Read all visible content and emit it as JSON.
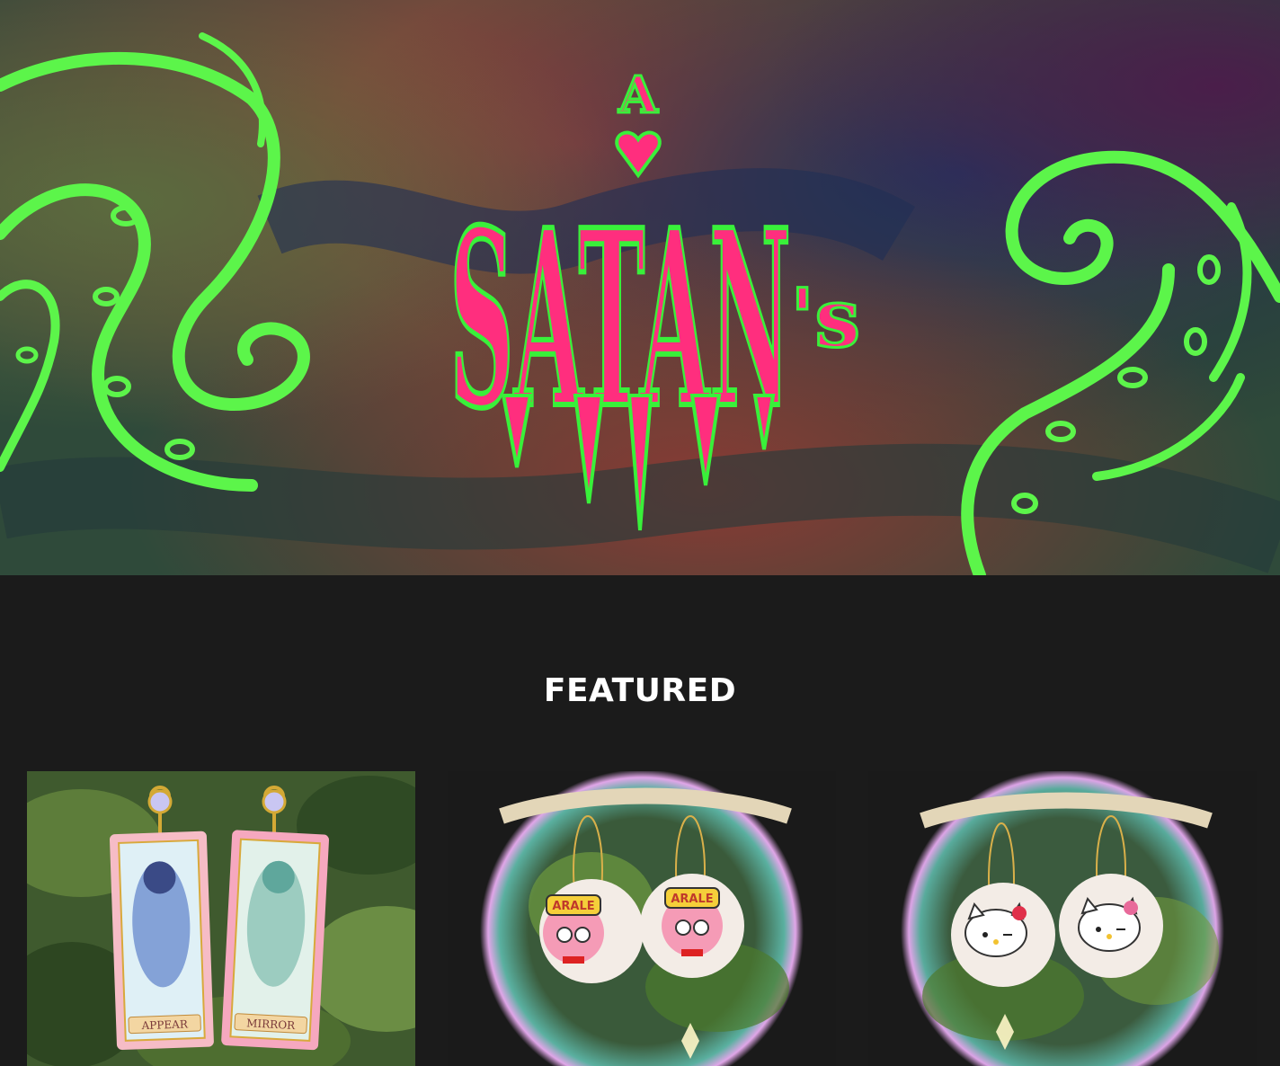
{
  "brand": {
    "logo_prefix": "A",
    "logo_main": "SATAN",
    "logo_suffix": "'s",
    "colors": {
      "logo_pink": "#ff2e7e",
      "logo_outline": "#39f03a",
      "tentacle_green": "#5cf54a",
      "page_bg": "#1b1b1b"
    }
  },
  "featured": {
    "title": "FEATURED",
    "products": [
      {
        "image_icon": "card-captor-earrings-image",
        "card_labels": [
          "APPEAR",
          "MIRROR"
        ]
      },
      {
        "image_icon": "arale-earrings-image",
        "badge_labels": [
          "ARALE",
          "ARALE"
        ]
      },
      {
        "image_icon": "hello-kitty-earrings-image"
      }
    ]
  }
}
